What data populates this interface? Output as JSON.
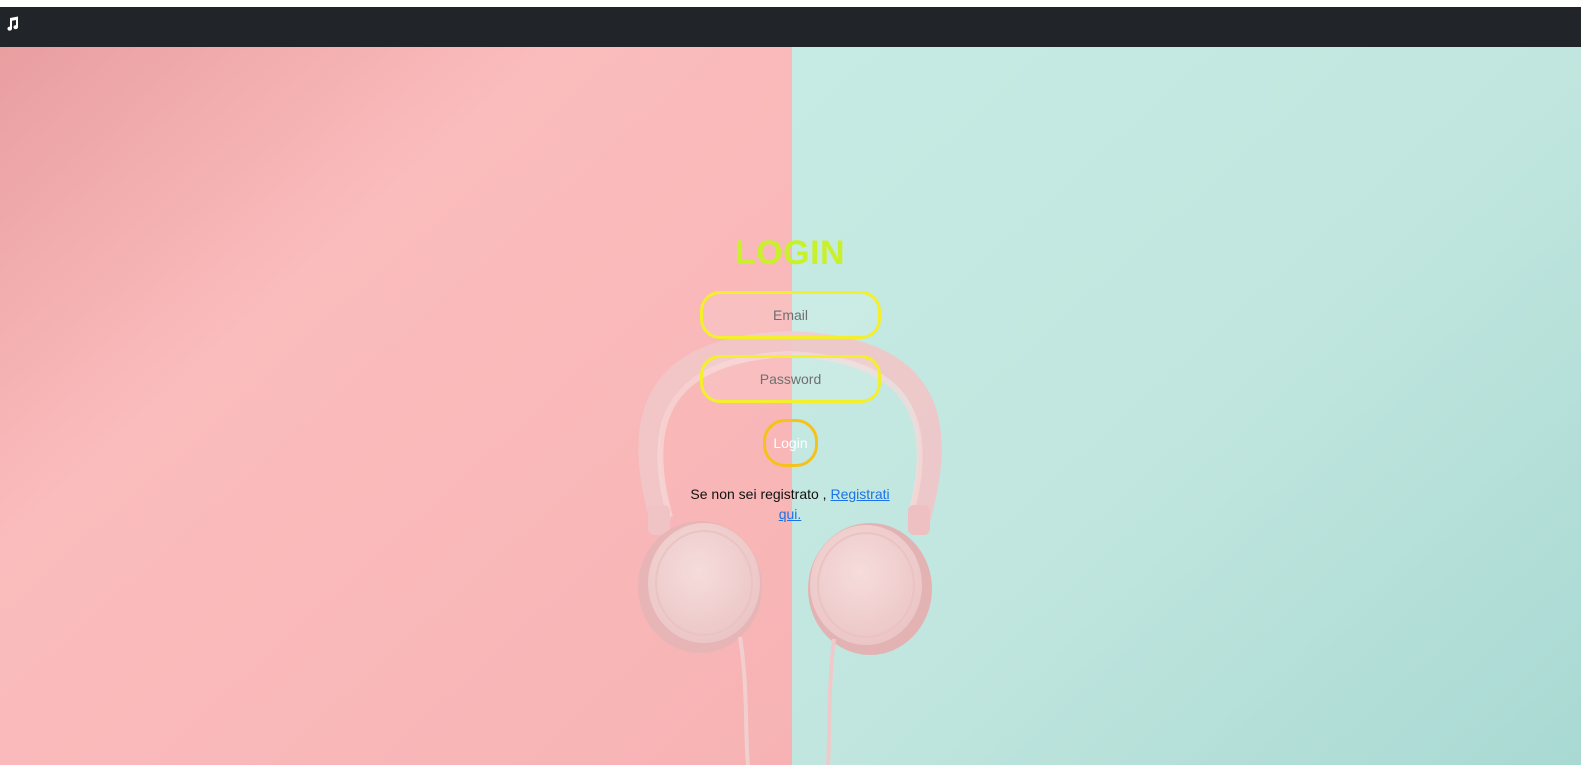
{
  "navbar": {
    "brand_icon": "music-note-icon",
    "background": "#212529"
  },
  "login": {
    "title": "LOGIN",
    "email_placeholder": "Email",
    "password_placeholder": "Password",
    "submit_label": "Login",
    "register_prompt": "Se non sei registrato , ",
    "register_link_label": "Registrati qui."
  },
  "colors": {
    "title": "#c8f12b",
    "input_border": "#f4ef2c",
    "button_border": "#f5c21c",
    "link": "#1a73e8",
    "background_left": "#f9bcbc",
    "background_right": "#c3e8e1"
  }
}
